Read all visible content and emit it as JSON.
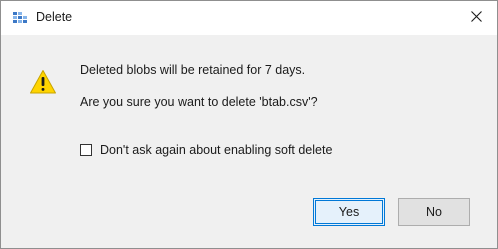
{
  "window": {
    "title": "Delete",
    "app_icon": "storage-explorer-icon",
    "close_icon": "close-icon"
  },
  "message": {
    "line1": "Deleted blobs will be retained for 7 days.",
    "line2": "Are you sure you want to delete 'btab.csv'?",
    "icon": "warning-icon"
  },
  "checkbox": {
    "label": "Don't ask again about enabling soft delete",
    "checked": false
  },
  "buttons": {
    "yes": "Yes",
    "no": "No"
  },
  "colors": {
    "accent": "#0078d7",
    "warning": "#ffd400"
  }
}
